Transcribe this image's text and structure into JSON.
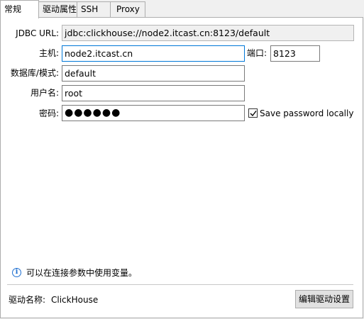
{
  "tabs": [
    {
      "label": "常规"
    },
    {
      "label": "驱动属性"
    },
    {
      "label": "SSH"
    },
    {
      "label": "Proxy"
    }
  ],
  "form": {
    "jdbc_url_label": "JDBC URL:",
    "jdbc_url_value": "jdbc:clickhouse://node2.itcast.cn:8123/default",
    "host_label": "主机:",
    "host_value": "node2.itcast.cn",
    "port_label": "端口:",
    "port_value": "8123",
    "database_label": "数据库/模式:",
    "database_value": "default",
    "user_label": "用户名:",
    "user_value": "root",
    "password_label": "密码:",
    "password_value": "●●●●●●",
    "save_password_label": "Save password locally",
    "save_password_checked": true
  },
  "info_text": "可以在连接参数中使用变量。",
  "driver": {
    "name_label": "驱动名称:",
    "name_value": "ClickHouse",
    "edit_button_label": "编辑驱动设置"
  },
  "colors": {
    "accent": "#0078d7",
    "info_icon": "#1e6fd0"
  }
}
